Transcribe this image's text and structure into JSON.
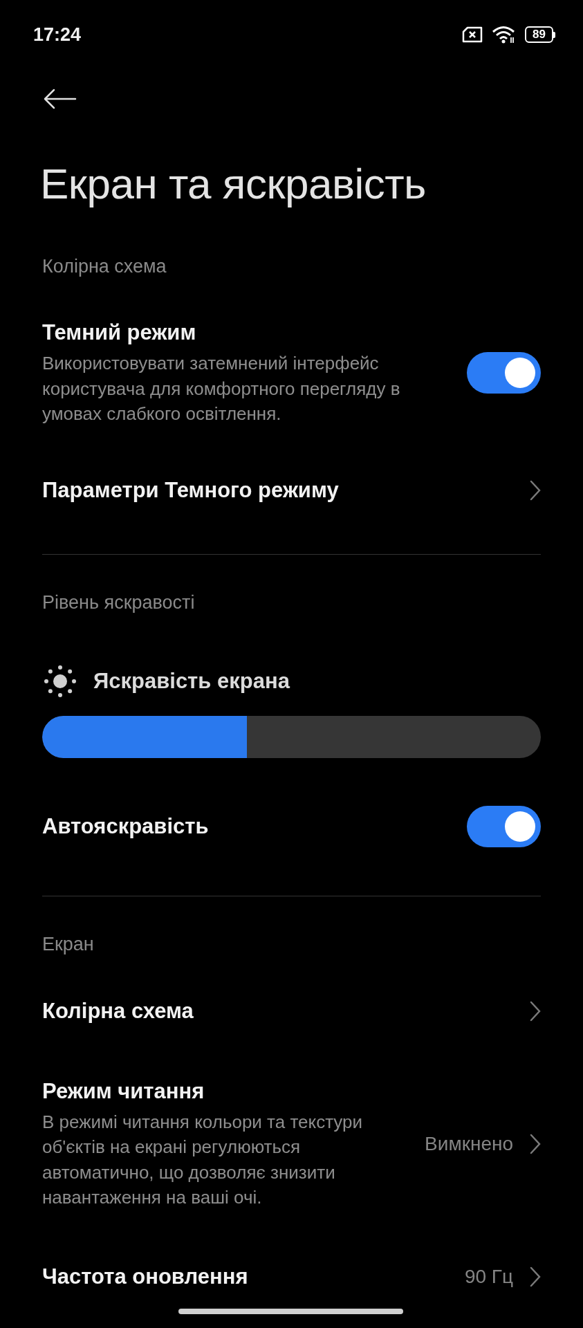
{
  "status_bar": {
    "time": "17:24",
    "battery": "89"
  },
  "title": "Екран та яскравість",
  "sections": [
    {
      "header": "Колірна схема",
      "items": [
        {
          "kind": "toggle",
          "title": "Темний режим",
          "description": "Використовувати затемнений інтерфейс користувача для комфортного перегляду в умовах слабкого освітлення.",
          "on": true
        },
        {
          "kind": "link",
          "title": "Параметри Темного режиму"
        }
      ]
    },
    {
      "header": "Рівень яскравості",
      "items": [
        {
          "kind": "slider",
          "title": "Яскравість екрана",
          "level": 0.41
        },
        {
          "kind": "toggle",
          "title": "Автояскравість",
          "on": true
        }
      ]
    },
    {
      "header": "Екран",
      "items": [
        {
          "kind": "link",
          "title": "Колірна схема"
        },
        {
          "kind": "link",
          "title": "Режим читання",
          "description": "В режимі читання кольори та текстури об'єктів на екрані регулюються автоматично, що дозволяє знизити навантаження на ваші очі.",
          "value": "Вимкнено"
        },
        {
          "kind": "link",
          "title": "Частота оновлення",
          "value": "90 Гц"
        }
      ]
    }
  ]
}
